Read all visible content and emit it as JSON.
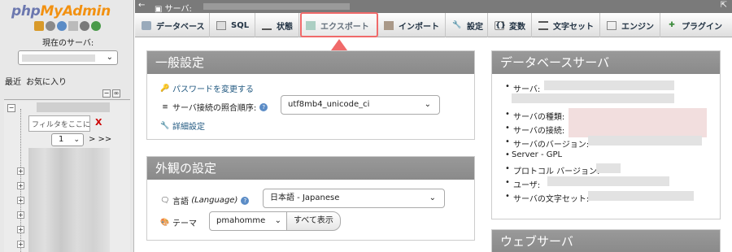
{
  "nav": {
    "logo_php": "php",
    "logo_myadmin": "MyAdmin",
    "server_label": "現在のサーバ:",
    "tab_recent": "最近",
    "tab_favorites": "お気に入り",
    "filter_placeholder": "フィルタをここに,",
    "filter_clear": "X",
    "page_value": "1",
    "page_next": "> >>"
  },
  "server_bar": {
    "label": "サーバ:"
  },
  "menu": {
    "tabs": [
      {
        "label": "データベース",
        "icon": "database-icon"
      },
      {
        "label": "SQL",
        "icon": "sql-icon"
      },
      {
        "label": "状態",
        "icon": "status-icon"
      },
      {
        "label": "エクスポート",
        "icon": "export-icon"
      },
      {
        "label": "インポート",
        "icon": "import-icon"
      },
      {
        "label": "設定",
        "icon": "wrench-icon"
      },
      {
        "label": "変数",
        "icon": "variables-icon"
      },
      {
        "label": "文字セット",
        "icon": "charset-icon"
      },
      {
        "label": "エンジン",
        "icon": "engine-icon"
      },
      {
        "label": "プラグイン",
        "icon": "plugin-icon"
      }
    ],
    "highlight_color": "#f06a6a"
  },
  "general": {
    "title": "一般設定",
    "change_password": "パスワードを変更する",
    "collation_label": "サーバ接続の照合順序:",
    "collation_value": "utf8mb4_unicode_ci",
    "advanced": "詳細設定"
  },
  "appearance": {
    "title": "外観の設定",
    "language_label": "言語",
    "language_en": "(Language)",
    "language_value": "日本語 - Japanese",
    "theme_label": "テーマ",
    "theme_value": "pmahomme",
    "show_all": "すべて表示"
  },
  "db_server": {
    "title": "データベースサーバ",
    "items": [
      "サーバ:",
      "サーバの種類:",
      "サーバの接続:",
      "サーバのバージョン:",
      "Server - GPL",
      "プロトコル バージョン:",
      "ユーザ:",
      "サーバの文字セット:"
    ]
  },
  "web_server": {
    "title": "ウェブサーバ"
  },
  "colors": {
    "panel_header": "#8e8e8e",
    "link": "#235a81",
    "logo_php": "#6c78af",
    "logo_myadmin": "#f29111"
  }
}
